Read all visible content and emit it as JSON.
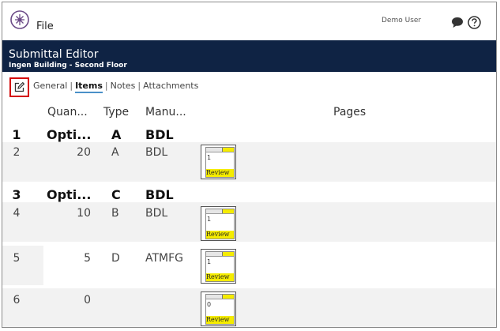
{
  "topbar": {
    "file_label": "File",
    "user_name": "Demo User"
  },
  "header": {
    "title": "Submittal Editor",
    "subtitle": "Ingen Building - Second Floor"
  },
  "tabs": [
    {
      "label": "General",
      "active": false
    },
    {
      "label": "Items",
      "active": true
    },
    {
      "label": "Notes",
      "active": false
    },
    {
      "label": "Attachments",
      "active": false
    }
  ],
  "columns": {
    "quantity": "Quan...",
    "type": "Type",
    "manufacturer": "Manu...",
    "pages": "Pages"
  },
  "rows": [
    {
      "num": "1",
      "qty": "Opti...",
      "type": "A",
      "mfg": "BDL"
    },
    {
      "num": "2",
      "qty": "20",
      "type": "A",
      "mfg": "BDL",
      "page": "1",
      "status": "Review"
    },
    {
      "num": "3",
      "qty": "Opti...",
      "type": "C",
      "mfg": "BDL"
    },
    {
      "num": "4",
      "qty": "10",
      "type": "B",
      "mfg": "BDL",
      "page": "1",
      "status": "Review"
    },
    {
      "num": "5",
      "qty": "5",
      "type": "D",
      "mfg": "ATMFG",
      "page": "1",
      "status": "Review"
    },
    {
      "num": "6",
      "qty": "0",
      "type": "",
      "mfg": "",
      "page": "0",
      "status": "Review"
    }
  ],
  "colors": {
    "header_bg": "#0f2344",
    "highlight": "#d40000",
    "review_badge": "#f5ec00",
    "tab_underline": "#4a90c8"
  },
  "icons": [
    "logo-icon",
    "chat-icon",
    "help-icon",
    "edit-icon"
  ]
}
